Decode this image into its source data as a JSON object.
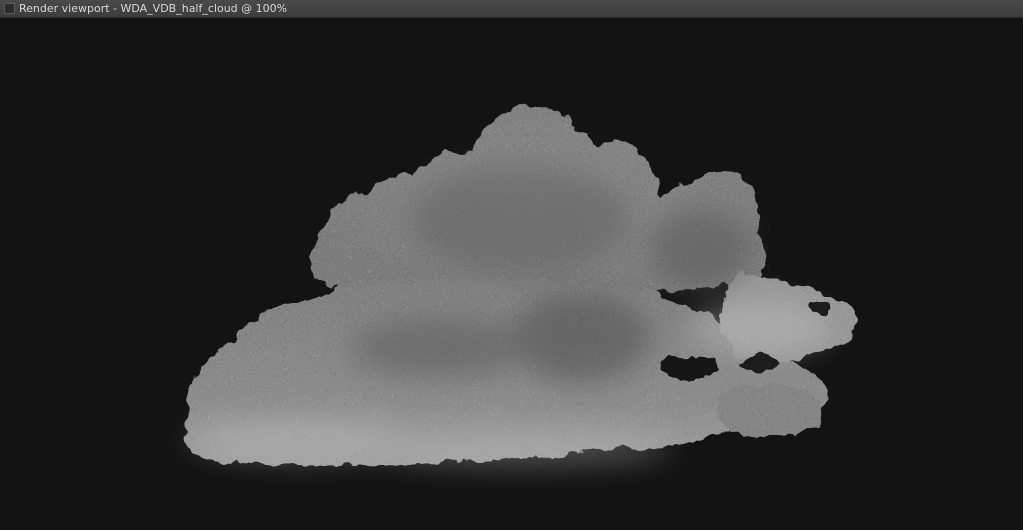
{
  "window": {
    "title": "Render viewport - WDA_VDB_half_cloud @ 100%"
  },
  "colors": {
    "titlebar": "#444444",
    "background": "#131313",
    "cloud_light": "#b8b8b8",
    "cloud_mid": "#8a8a8a",
    "cloud_shadow": "#5c5c5c"
  },
  "viewport": {
    "content": "rendered volumetric cloud",
    "icon": "render-window-icon"
  }
}
